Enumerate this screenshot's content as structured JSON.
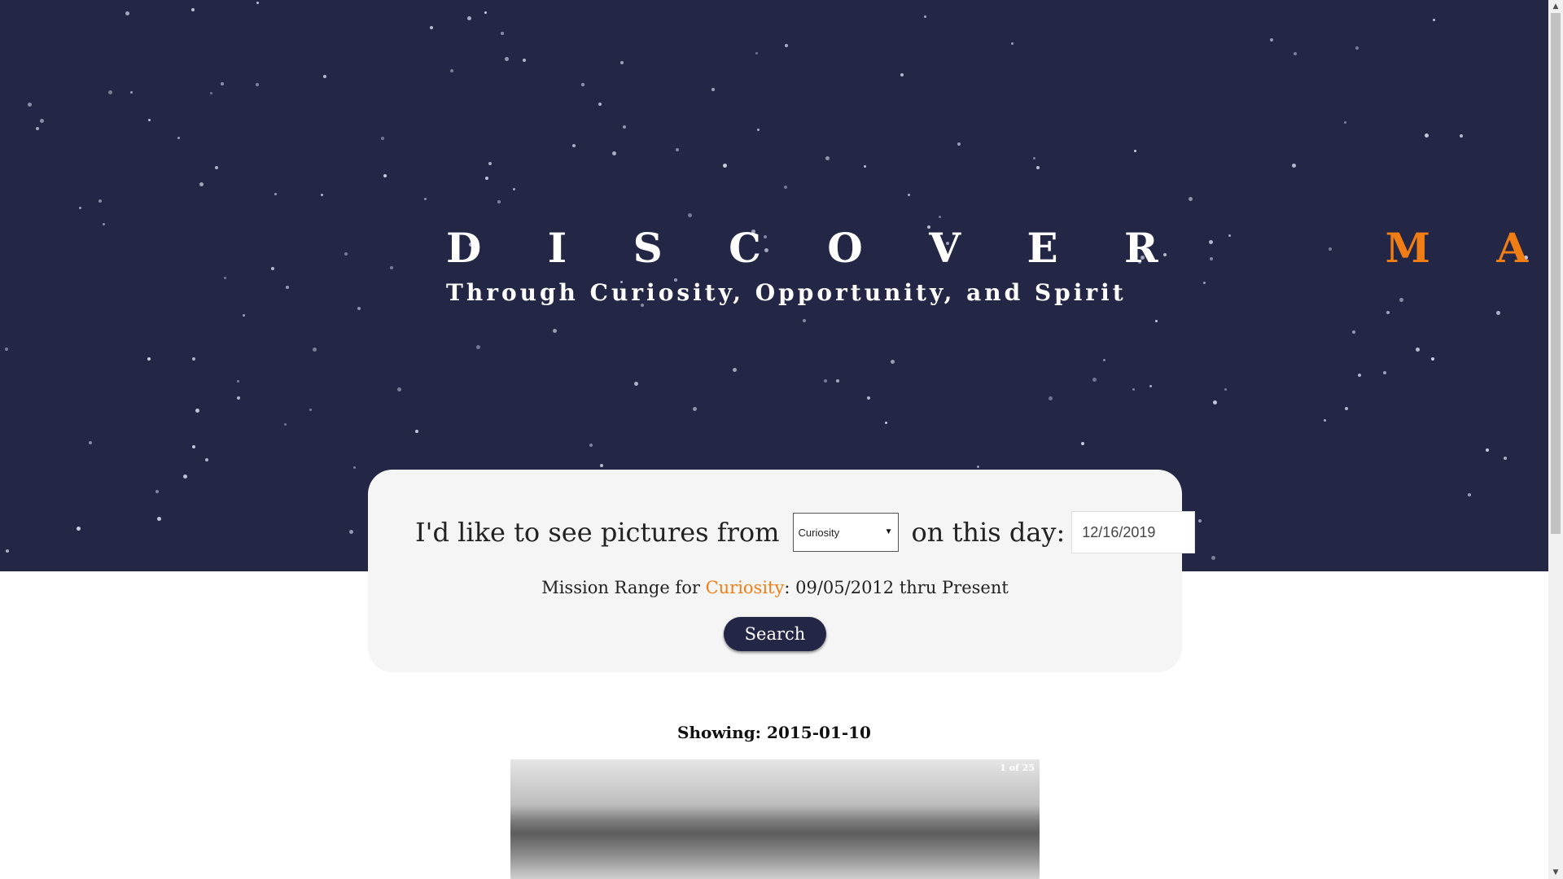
{
  "hero": {
    "title_main": "D I S C O V E R",
    "title_accent": "M A R S",
    "subtitle": "Through Curiosity, Opportunity, and Spirit",
    "background_color": "#232645",
    "accent_color": "#f07e14"
  },
  "search": {
    "prompt_prefix": "I'd like to see pictures from",
    "rover_select_value": "Curiosity",
    "prompt_suffix": "on this day:",
    "date_value": "12/16/2019",
    "mission_range_prefix": "Mission Range for",
    "mission_range_rover": "Curiosity",
    "mission_range_suffix": ": 09/05/2012 thru Present",
    "button_label": "Search"
  },
  "results": {
    "showing_label": "Showing: 2015-01-10",
    "photo_counter": "1 of 25"
  },
  "icons": {
    "select_arrow": "caret-down-icon",
    "scroll_up": "scroll-up-icon",
    "scroll_down": "scroll-down-icon"
  }
}
